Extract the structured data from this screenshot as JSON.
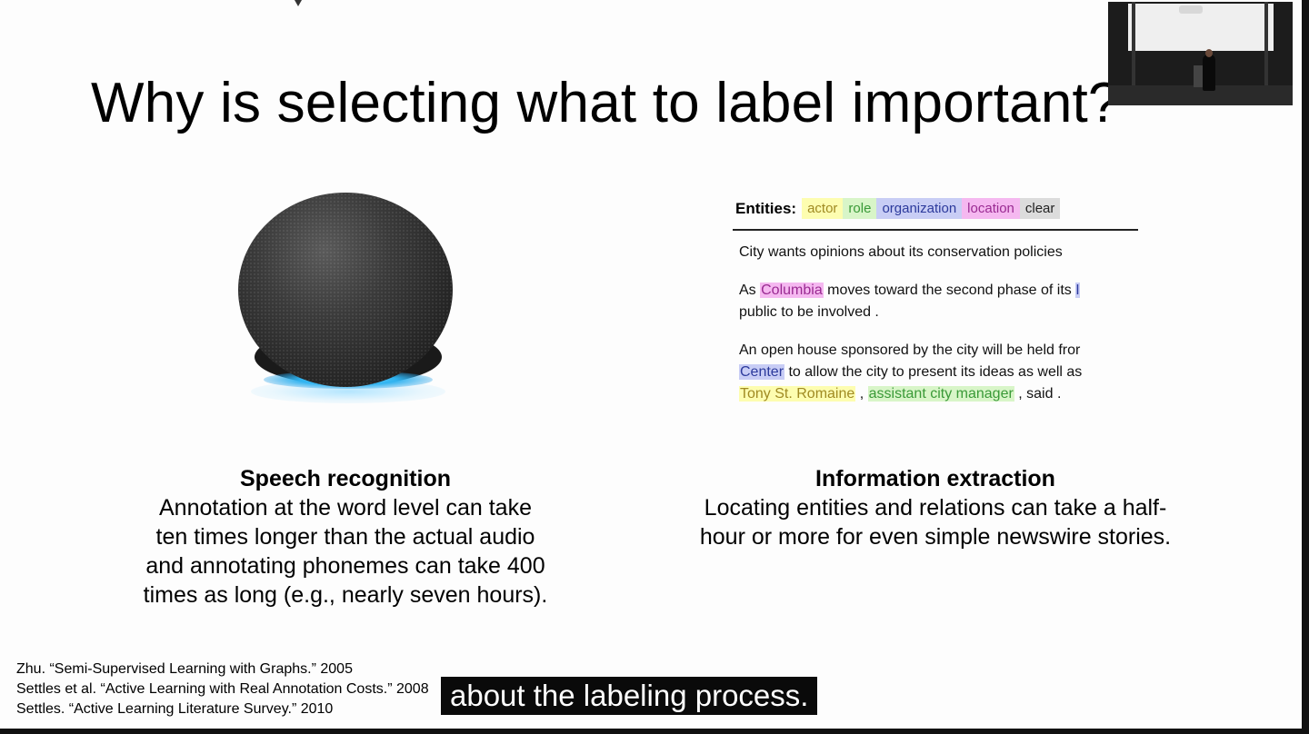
{
  "slide": {
    "title": "Why is selecting what to label important?"
  },
  "entity_panel": {
    "label": "Entities:",
    "tags": [
      {
        "text": "actor",
        "bg": "#fdfdb0",
        "fg": "#a08a22"
      },
      {
        "text": "role",
        "bg": "#d8f5c8",
        "fg": "#3a9a38"
      },
      {
        "text": "organization",
        "bg": "#c8cdf5",
        "fg": "#2c3a9c"
      },
      {
        "text": "location",
        "bg": "#f5b8f0",
        "fg": "#9a2a92"
      },
      {
        "text": "clear",
        "bg": "#dcdcdc",
        "fg": "#222"
      }
    ],
    "lines": {
      "l1": "City wants opinions about its conservation policies",
      "l2_pre": "As ",
      "l2_hl": "Columbia",
      "l2_post": " moves toward the second phase of its ",
      "l2_tail": "I",
      "l3": "public to be involved .",
      "l4": "An open house sponsored by the city will be held fror",
      "l5_hl": "Center",
      "l5_post": " to allow the city to present its ideas as well as",
      "l6_hl1": "Tony St. Romaine",
      "l6_mid": " , ",
      "l6_hl2": "assistant city manager",
      "l6_post": " , said ."
    }
  },
  "left_caption": {
    "title": "Speech recognition",
    "body": "Annotation at the word level can take\nten times longer than the actual audio\nand annotating phonemes can take 400\ntimes as long (e.g., nearly seven hours)."
  },
  "right_caption": {
    "title": "Information extraction",
    "body": "Locating entities and relations can take a half-\nhour or more for even simple newswire stories."
  },
  "references": [
    "Zhu. “Semi-Supervised Learning with Graphs.” 2005",
    "Settles et al. “Active Learning with Real Annotation Costs.” 2008",
    "Settles. “Active Learning Literature Survey.” 2010"
  ],
  "subtitle": "about the labeling process.",
  "colors": {
    "speaker_ring": "#2fb3f0",
    "subtitle_bg": "#0a0a0a"
  }
}
